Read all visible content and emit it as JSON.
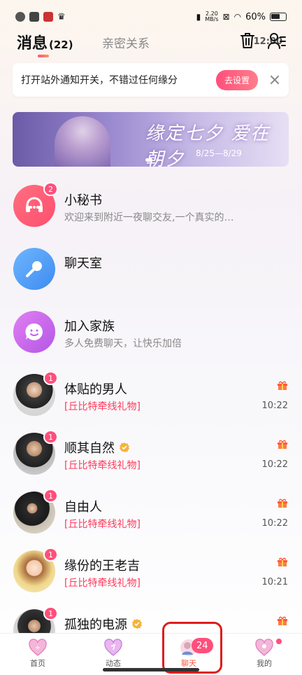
{
  "status_bar": {
    "time": "12:00",
    "net_speed_value": "2.20",
    "net_speed_unit": "MB/s",
    "battery": "60%"
  },
  "header": {
    "tab_messages": "消息",
    "tab_messages_count": "(22)",
    "tab_intimacy": "亲密关系"
  },
  "notice": {
    "text": "打开站外通知开关，不错过任何缘分",
    "button": "去设置"
  },
  "banner": {
    "title": "缘定七夕 爱在朝夕",
    "date": "8/25—8/29"
  },
  "conversations": [
    {
      "name": "小秘书",
      "preview": "欢迎来到附近一夜聊交友,一个真实的…",
      "badge": "2",
      "time": "",
      "gift": false,
      "verified": false
    },
    {
      "name": "聊天室",
      "preview": "",
      "badge": "",
      "time": "",
      "gift": false,
      "verified": false
    },
    {
      "name": "加入家族",
      "preview": "多人免费聊天，让快乐加倍",
      "badge": "",
      "time": "",
      "gift": false,
      "verified": false
    },
    {
      "name": "体贴的男人",
      "preview": "[丘比特牵线礼物]",
      "badge": "1",
      "time": "10:22",
      "gift": true,
      "verified": false
    },
    {
      "name": "顺其自然",
      "preview": "[丘比特牵线礼物]",
      "badge": "1",
      "time": "10:22",
      "gift": true,
      "verified": true
    },
    {
      "name": "自由人",
      "preview": "[丘比特牵线礼物]",
      "badge": "1",
      "time": "10:22",
      "gift": true,
      "verified": false
    },
    {
      "name": "缘份的王老吉",
      "preview": "[丘比特牵线礼物]",
      "badge": "1",
      "time": "10:21",
      "gift": true,
      "verified": false
    },
    {
      "name": "孤独的电源",
      "preview": "",
      "badge": "1",
      "time": "",
      "gift": true,
      "verified": true
    }
  ],
  "bottom_nav": [
    {
      "label": "首页",
      "icon": "home-heart-icon"
    },
    {
      "label": "动态",
      "icon": "moments-heart-icon"
    },
    {
      "label": "聊天",
      "icon": "chat-avatar-icon",
      "badge": "24"
    },
    {
      "label": "我的",
      "icon": "me-heart-icon"
    }
  ],
  "colors": {
    "accent": "#ff4f7b",
    "active_nav": "#ff5a3c",
    "preview_pink": "#ff3a5c"
  }
}
